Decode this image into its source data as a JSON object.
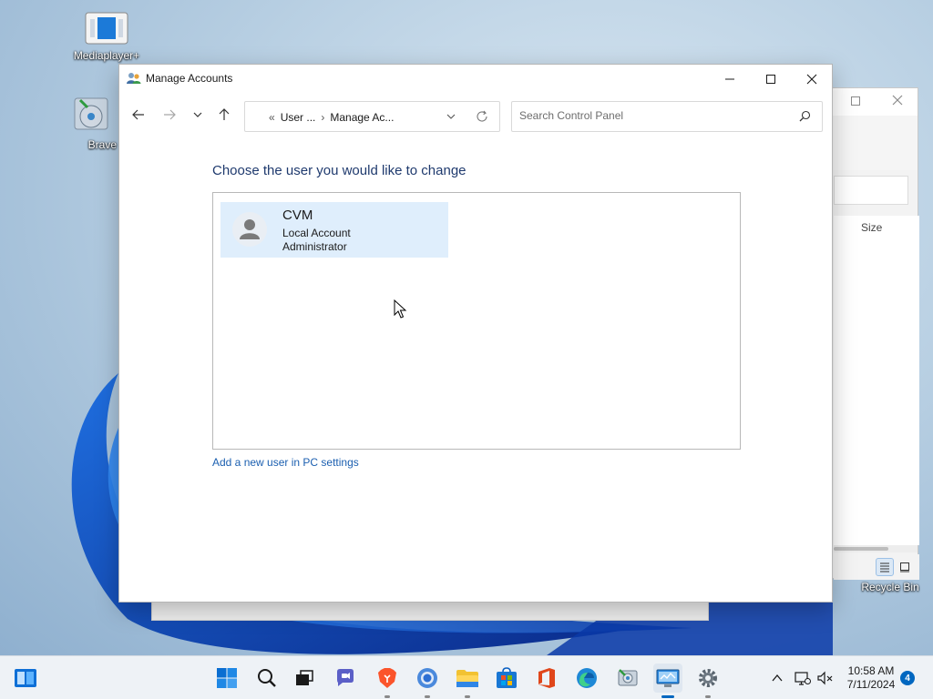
{
  "desktop": {
    "icons": [
      {
        "label": "Mediaplayer+"
      },
      {
        "label": "Brave"
      },
      {
        "label": "Recycle Bin"
      }
    ]
  },
  "background_window": {
    "column_header": "Size"
  },
  "window": {
    "title": "Manage Accounts",
    "address": {
      "crumb_overflow": "«",
      "crumb_1": "User ...",
      "separator": "›",
      "crumb_2": "Manage Ac..."
    },
    "search": {
      "placeholder": "Search Control Panel"
    },
    "heading": "Choose the user you would like to change",
    "users": [
      {
        "name": "CVM",
        "type": "Local Account",
        "role": "Administrator"
      }
    ],
    "add_user_link": "Add a new user in PC settings"
  },
  "taskbar": {
    "time": "10:58 AM",
    "date": "7/11/2024",
    "notification_count": "4",
    "apps": [
      "start-icon",
      "search-icon",
      "task-view-icon",
      "chat-icon",
      "brave-icon",
      "chrome-icon",
      "file-explorer-icon",
      "store-icon",
      "office-icon",
      "edge-icon",
      "app-icon",
      "control-panel-icon",
      "settings-icon"
    ]
  },
  "colors": {
    "accent": "#0067c0",
    "heading": "#1f3a6e",
    "link": "#1b5fb0",
    "selected_tile": "#dfeefc"
  }
}
